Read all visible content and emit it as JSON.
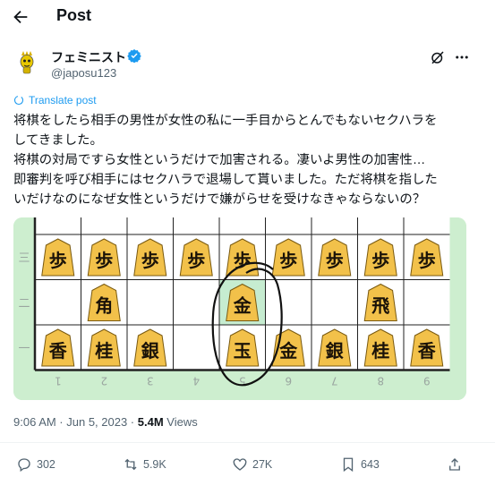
{
  "header": {
    "title": "Post"
  },
  "author": {
    "name": "フェミニスト",
    "handle": "@japosu123"
  },
  "translate_label": "Translate post",
  "body_lines": [
    "将棋をしたら相手の男性が女性の私に一手目からとんでもないセクハラを",
    "してきました。",
    "将棋の対局ですら女性というだけで加害される。凄いよ男性の加害性…",
    "即審判を呼び相手にはセクハラで退場して貰いました。ただ将棋を指した",
    "いだけなのになぜ女性というだけで嫌がらせを受けなきゃならないの？"
  ],
  "board": {
    "rank_labels": [
      "三",
      "二",
      "一"
    ],
    "file_labels": [
      "1",
      "2",
      "3",
      "4",
      "5",
      "6",
      "7",
      "8",
      "9"
    ],
    "pieces": [
      {
        "file": 0,
        "rank": 0,
        "char": "歩"
      },
      {
        "file": 1,
        "rank": 0,
        "char": "歩"
      },
      {
        "file": 2,
        "rank": 0,
        "char": "歩"
      },
      {
        "file": 3,
        "rank": 0,
        "char": "歩"
      },
      {
        "file": 4,
        "rank": 0,
        "char": "歩"
      },
      {
        "file": 5,
        "rank": 0,
        "char": "歩"
      },
      {
        "file": 6,
        "rank": 0,
        "char": "歩"
      },
      {
        "file": 7,
        "rank": 0,
        "char": "歩"
      },
      {
        "file": 8,
        "rank": 0,
        "char": "歩"
      },
      {
        "file": 1,
        "rank": 1,
        "char": "角"
      },
      {
        "file": 4,
        "rank": 1,
        "char": "金"
      },
      {
        "file": 7,
        "rank": 1,
        "char": "飛"
      },
      {
        "file": 0,
        "rank": 2,
        "char": "香"
      },
      {
        "file": 1,
        "rank": 2,
        "char": "桂"
      },
      {
        "file": 2,
        "rank": 2,
        "char": "銀"
      },
      {
        "file": 4,
        "rank": 2,
        "char": "玉"
      },
      {
        "file": 5,
        "rank": 2,
        "char": "金"
      },
      {
        "file": 6,
        "rank": 2,
        "char": "銀"
      },
      {
        "file": 7,
        "rank": 2,
        "char": "桂"
      },
      {
        "file": 8,
        "rank": 2,
        "char": "香"
      }
    ],
    "highlight": {
      "file": 4,
      "rank": 1
    }
  },
  "meta": {
    "time": "9:06 AM · Jun 5, 2023 · ",
    "views_count": "5.4M",
    "views_label": " Views"
  },
  "actions": {
    "replies": "302",
    "reposts": "5.9K",
    "likes": "27K",
    "bookmarks": "643"
  },
  "colors": {
    "link": "#1d9bf0",
    "board": "#ffffff",
    "board_margin": "#cdeecf",
    "piece": "#f2c14a"
  }
}
